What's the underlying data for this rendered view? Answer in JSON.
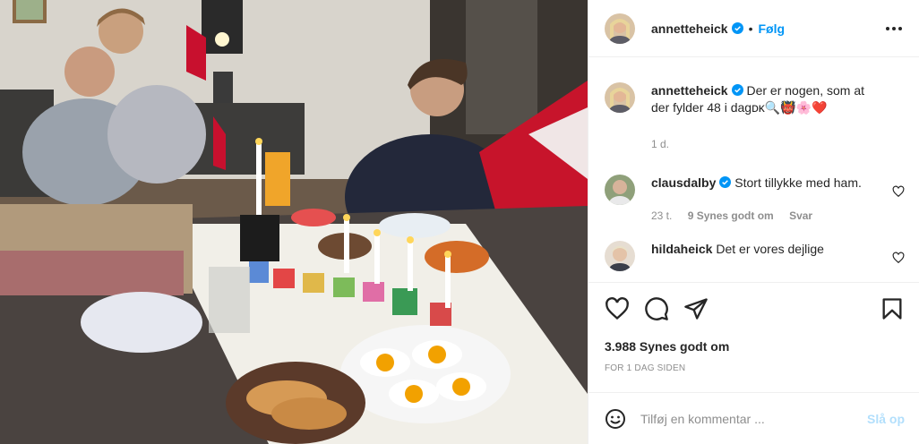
{
  "post": {
    "username": "annetteheick",
    "follow_label": "Følg",
    "separator": "•",
    "caption": {
      "username": "annetteheick",
      "text": "Der er nogen, som at der fylder 48 i dag",
      "emoji_suffix": "ᴅᴋ🔍👹🌸❤️",
      "time": "1 d."
    },
    "comments": [
      {
        "username": "clausdalby",
        "verified": true,
        "text": "Stort tillykke med ham.",
        "time": "23 t.",
        "likes": "9 Synes godt om",
        "reply": "Svar"
      },
      {
        "username": "hildaheick",
        "verified": false,
        "text": "Det er vores dejlige"
      }
    ],
    "likes_text": "3.988 Synes godt om",
    "date_text": "FOR 1 DAG SIDEN",
    "comment_placeholder": "Tilføj en kommentar ...",
    "post_button": "Slå op"
  },
  "colors": {
    "accent": "#0095f6",
    "post_disabled": "#b2dffc",
    "muted": "#8e8e8e",
    "heart_red": "#ed4956"
  },
  "icons": [
    "verified-icon",
    "more-icon",
    "heart-icon",
    "comment-icon",
    "share-icon",
    "bookmark-icon",
    "emoji-icon"
  ]
}
